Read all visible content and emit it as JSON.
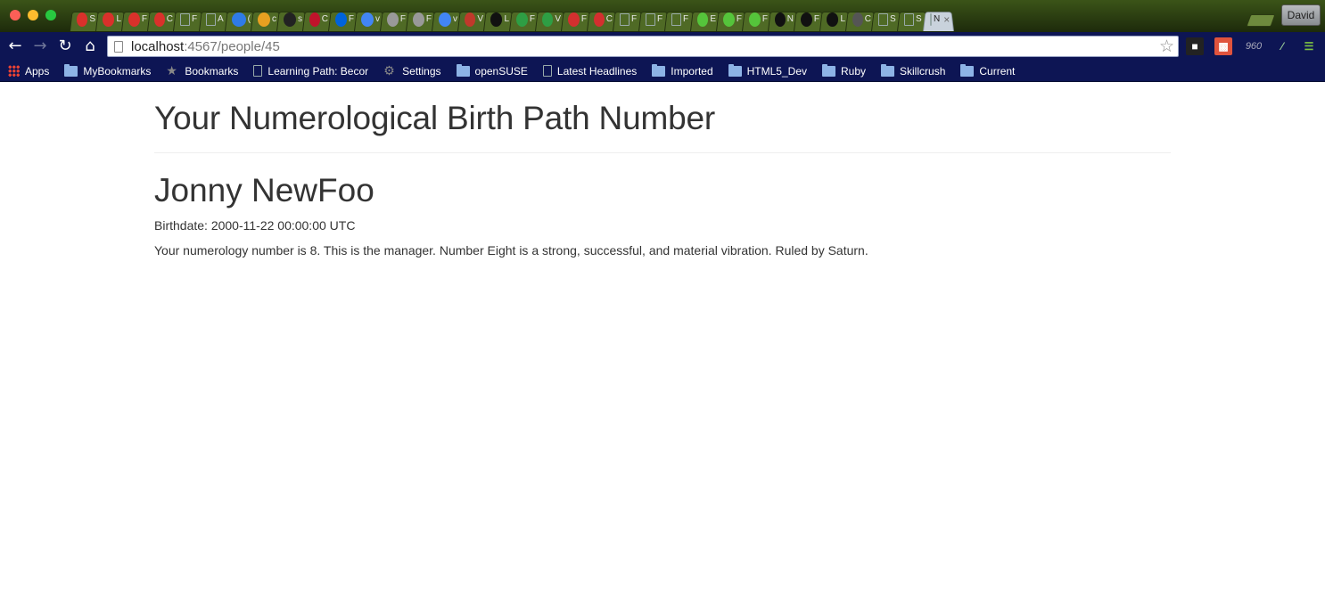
{
  "browser": {
    "tabs": [
      {
        "icon": "red-circle-icon",
        "label": "S",
        "color": "#d9312b"
      },
      {
        "icon": "red-circle-icon",
        "label": "L",
        "color": "#d9312b"
      },
      {
        "icon": "red-circle-icon",
        "label": "F",
        "color": "#d9312b"
      },
      {
        "icon": "red-circle-icon",
        "label": "C",
        "color": "#d9312b"
      },
      {
        "icon": "blank-page-icon",
        "label": "F",
        "color": ""
      },
      {
        "icon": "blank-page-icon",
        "label": "A",
        "color": ""
      },
      {
        "icon": "chat-icon",
        "label": "(",
        "color": "#2f7be6"
      },
      {
        "icon": "pinwheel-icon",
        "label": "c",
        "color": "#e8a021"
      },
      {
        "icon": "github-icon",
        "label": "s",
        "color": "#222222"
      },
      {
        "icon": "dr-icon",
        "label": "C",
        "color": "#c0132b"
      },
      {
        "icon": "flickr-icon",
        "label": "F",
        "color": "#0063dc"
      },
      {
        "icon": "google-icon",
        "label": "v",
        "color": "#4285f4"
      },
      {
        "icon": "figure-icon",
        "label": "F",
        "color": "#999999"
      },
      {
        "icon": "figure-icon",
        "label": "F",
        "color": "#999999"
      },
      {
        "icon": "google-icon",
        "label": "v",
        "color": "#4285f4"
      },
      {
        "icon": "q-icon",
        "label": "V",
        "color": "#c0392b"
      },
      {
        "icon": "g-icon",
        "label": "L",
        "color": "#111111"
      },
      {
        "icon": "grid-icon",
        "label": "F",
        "color": "#2e9e44"
      },
      {
        "icon": "grid-icon",
        "label": "V",
        "color": "#2e9e44"
      },
      {
        "icon": "rp-icon",
        "label": "F",
        "color": "#d32f2f"
      },
      {
        "icon": "rp-icon",
        "label": "C",
        "color": "#d32f2f"
      },
      {
        "icon": "blank-page-icon",
        "label": "F",
        "color": ""
      },
      {
        "icon": "blank-page-icon",
        "label": "F",
        "color": ""
      },
      {
        "icon": "blank-page-icon",
        "label": "F",
        "color": ""
      },
      {
        "icon": "u-icon",
        "label": "E",
        "color": "#55c43b"
      },
      {
        "icon": "u-icon",
        "label": "F",
        "color": "#55c43b"
      },
      {
        "icon": "u-icon",
        "label": "F",
        "color": "#55c43b"
      },
      {
        "icon": "panda-icon",
        "label": "N",
        "color": "#111111"
      },
      {
        "icon": "panda-icon",
        "label": "F",
        "color": "#111111"
      },
      {
        "icon": "panda-icon",
        "label": "L",
        "color": "#111111"
      },
      {
        "icon": "o-icon",
        "label": "C",
        "color": "#555555"
      },
      {
        "icon": "blank-page-icon",
        "label": "S",
        "color": ""
      },
      {
        "icon": "blank-page-icon",
        "label": "S",
        "color": ""
      },
      {
        "icon": "blank-page-icon",
        "label": "N",
        "color": "",
        "active": true
      }
    ],
    "profile_name": "David",
    "url_host": "localhost",
    "url_path": ":4567/people/45",
    "bookmarks": [
      {
        "icon": "apps-icon",
        "label": "Apps"
      },
      {
        "icon": "folder-icon",
        "label": "MyBookmarks"
      },
      {
        "icon": "star-icon",
        "label": "Bookmarks"
      },
      {
        "icon": "page-icon",
        "label": "Learning Path: Becor"
      },
      {
        "icon": "gear-icon",
        "label": "Settings"
      },
      {
        "icon": "folder-icon",
        "label": "openSUSE"
      },
      {
        "icon": "page-icon",
        "label": "Latest Headlines"
      },
      {
        "icon": "folder-icon",
        "label": "Imported"
      },
      {
        "icon": "folder-icon",
        "label": "HTML5_Dev"
      },
      {
        "icon": "folder-icon",
        "label": "Ruby"
      },
      {
        "icon": "folder-icon",
        "label": "Skillcrush"
      },
      {
        "icon": "folder-icon",
        "label": "Current"
      }
    ],
    "extension_960_label": "960"
  },
  "page": {
    "title": "Your Numerological Birth Path Number",
    "person_name": "Jonny NewFoo",
    "birthdate": "Birthdate: 2000-11-22 00:00:00 UTC",
    "description": "Your numerology number is 8. This is the manager. Number Eight is a strong, successful, and material vibration. Ruled by Saturn."
  }
}
